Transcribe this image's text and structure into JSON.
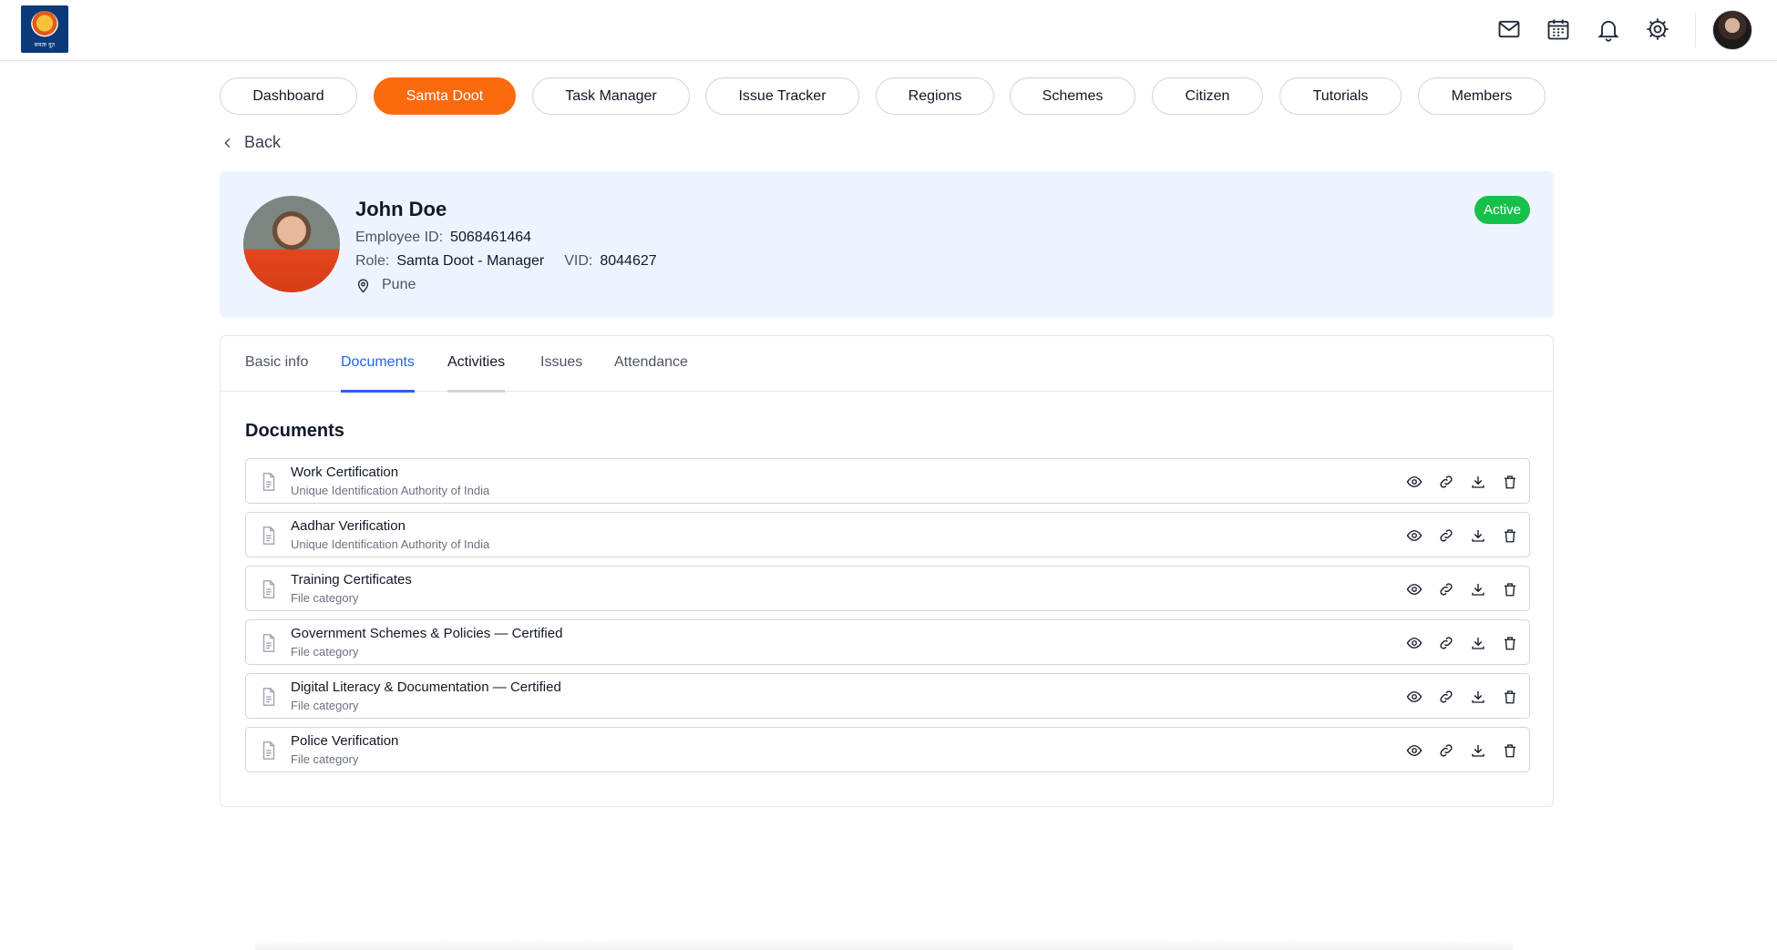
{
  "header": {
    "logo_text": "समता दूत",
    "icons": [
      "mail-icon",
      "calendar-icon",
      "bell-icon",
      "settings-icon"
    ]
  },
  "nav": {
    "items": [
      {
        "label": "Dashboard",
        "active": false
      },
      {
        "label": "Samta Doot",
        "active": true
      },
      {
        "label": "Task Manager",
        "active": false
      },
      {
        "label": "Issue Tracker",
        "active": false
      },
      {
        "label": "Regions",
        "active": false
      },
      {
        "label": "Schemes",
        "active": false
      },
      {
        "label": "Citizen",
        "active": false
      },
      {
        "label": "Tutorials",
        "active": false
      },
      {
        "label": "Members",
        "active": false
      }
    ],
    "accent_color": "#fb6a0d"
  },
  "back_label": "Back",
  "profile": {
    "name": "John Doe",
    "employee_id_label": "Employee ID:",
    "employee_id": "5068461464",
    "role_label": "Role:",
    "role": "Samta Doot - Manager",
    "vid_label": "VID:",
    "vid": "8044627",
    "location": "Pune",
    "status": "Active",
    "status_color": "#16c14b"
  },
  "tabs": [
    {
      "label": "Basic info",
      "state": "default"
    },
    {
      "label": "Documents",
      "state": "active"
    },
    {
      "label": "Activities",
      "state": "hover"
    },
    {
      "label": "Issues",
      "state": "default"
    },
    {
      "label": "Attendance",
      "state": "default"
    }
  ],
  "documents": {
    "title": "Documents",
    "items": [
      {
        "name": "Work Certification",
        "sub": "Unique Identification Authority of India"
      },
      {
        "name": "Aadhar Verification",
        "sub": "Unique Identification Authority of India"
      },
      {
        "name": "Training Certificates",
        "sub": "File category"
      },
      {
        "name": "Government Schemes & Policies — Certified",
        "sub": "File category"
      },
      {
        "name": "Digital Literacy & Documentation — Certified",
        "sub": "File category"
      },
      {
        "name": "Police Verification",
        "sub": "File category"
      }
    ],
    "row_actions": [
      "eye-icon",
      "link-icon",
      "download-icon",
      "trash-icon"
    ]
  }
}
